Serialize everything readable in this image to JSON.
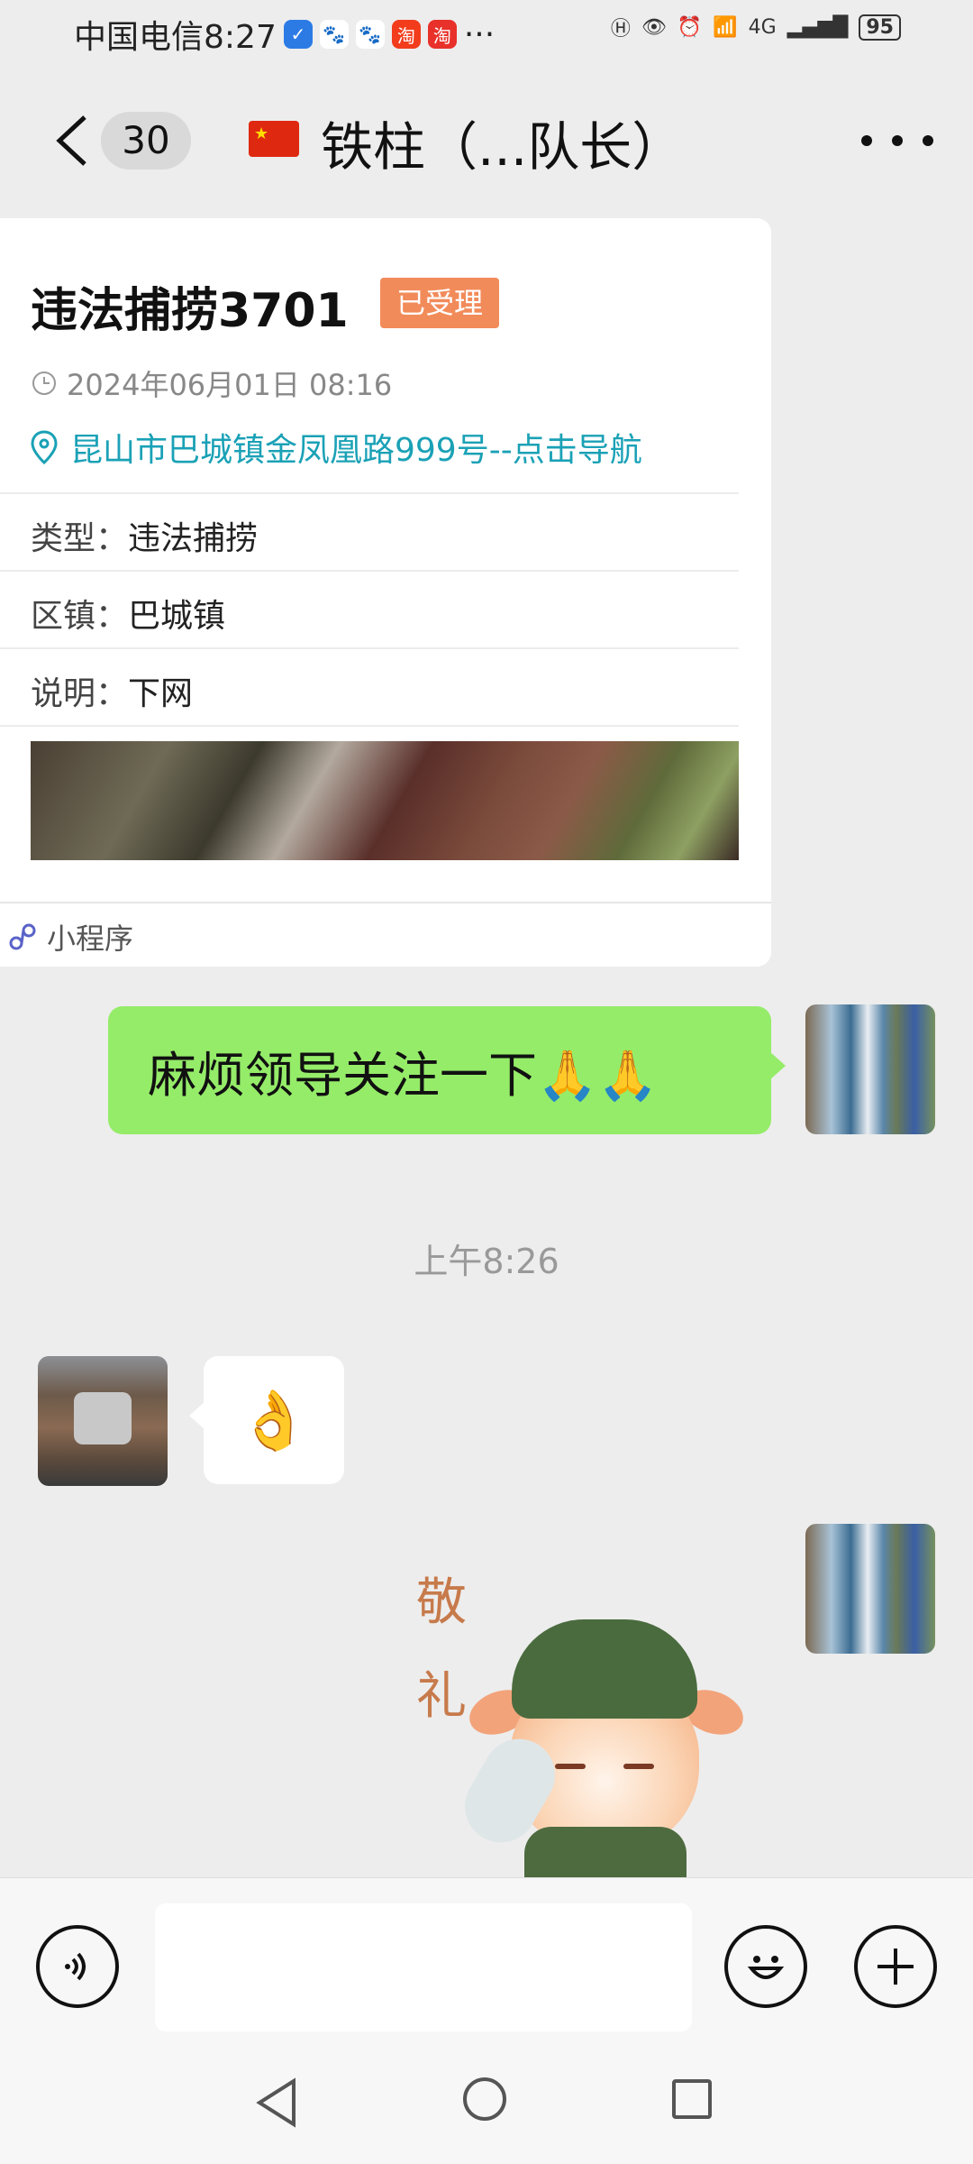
{
  "status_bar": {
    "carrier_time": "中国电信8:27",
    "app_icons": [
      "shield-app-icon",
      "baidu-icon",
      "baidu-icon",
      "taobao-icon",
      "taobao-sale-icon"
    ],
    "more": "···",
    "network": "4G",
    "battery": "95"
  },
  "header": {
    "unread_count": "30",
    "title": "铁柱（...队长）"
  },
  "card": {
    "title": "违法捕捞3701",
    "status": "已受理",
    "datetime": "2024年06月01日 08:16",
    "location": "昆山市巴城镇金凤凰路999号--点击导航",
    "rows": [
      {
        "label": "类型：",
        "value": "违法捕捞"
      },
      {
        "label": "区镇：",
        "value": "巴城镇"
      },
      {
        "label": "说明：",
        "value": "下网"
      }
    ],
    "footer_label": "小程序"
  },
  "messages": {
    "outgoing_text": "麻烦领导关注一下🙏🙏",
    "timestamp": "上午8:26",
    "incoming_emoji": "👌",
    "sticker_text": "敬礼"
  },
  "colors": {
    "bubble_green": "#95ec69",
    "status_chip": "#f28b5a",
    "location_link": "#1aa1b6",
    "background": "#ededed"
  }
}
